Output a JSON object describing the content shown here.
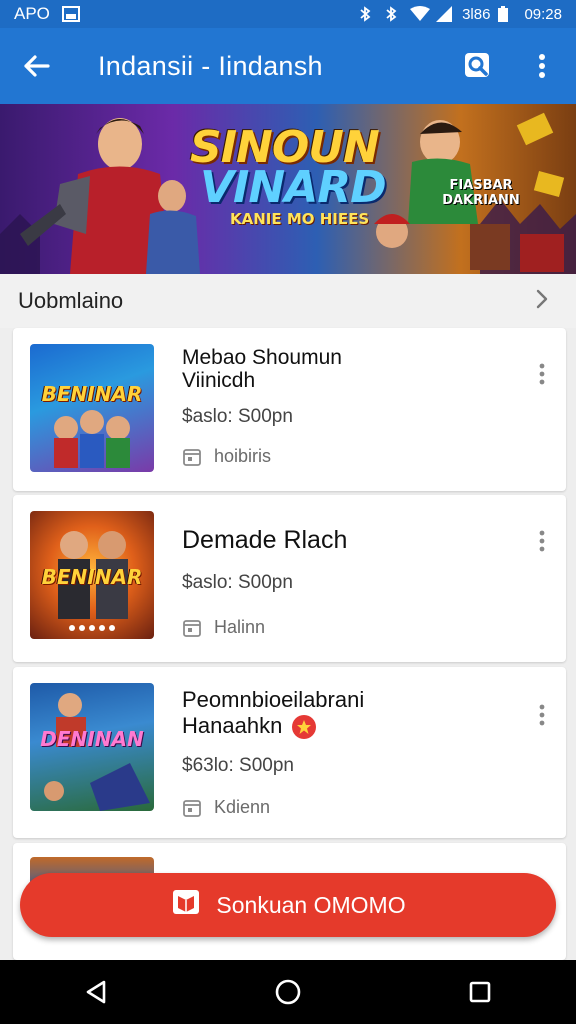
{
  "status_bar": {
    "carrier": "APO",
    "speed": "3l86",
    "time": "09:28"
  },
  "app_bar": {
    "title": "Indansii - Iindansh",
    "back_icon": "arrow-back-icon",
    "search_icon": "search-icon",
    "menu_icon": "more-vert-icon"
  },
  "banner": {
    "title_line1": "SINOUN",
    "title_line2": "VINARD",
    "subtitle": "KANIE MO HIEES",
    "badge": "FIASBAR DAKRIANN"
  },
  "section": {
    "label": "Uobmlaino",
    "chevron_icon": "chevron-right-icon"
  },
  "items": [
    {
      "name_line1": "Mebao Shoumun",
      "name_line2": "Viinicdh",
      "thumb_text": "BENINAR",
      "price": "$aslo: S00pn",
      "meta": "hoibiris",
      "meta_icon": "calendar-icon"
    },
    {
      "name_line1": "Demade Rlach",
      "name_line2": "",
      "thumb_text": "BENINAR",
      "price": "$aslo: S00pn",
      "meta": "Halinn",
      "meta_icon": "calendar-icon"
    },
    {
      "name_line1": "Peomnbioeilabrani",
      "name_line2": "Hanaahkn",
      "thumb_text": "DENINAN",
      "price": "$63lo: S00pn",
      "meta": "Kdienn",
      "meta_icon": "calendar-icon"
    }
  ],
  "fab": {
    "label": "Sonkuan OMOMO",
    "icon": "book-icon"
  },
  "nav": {
    "back_icon": "nav-back-icon",
    "home_icon": "nav-home-icon",
    "recents_icon": "nav-recents-icon"
  },
  "colors": {
    "primary": "#2276d2",
    "status_bar": "#1e6cc4",
    "accent": "#e53a2b"
  }
}
